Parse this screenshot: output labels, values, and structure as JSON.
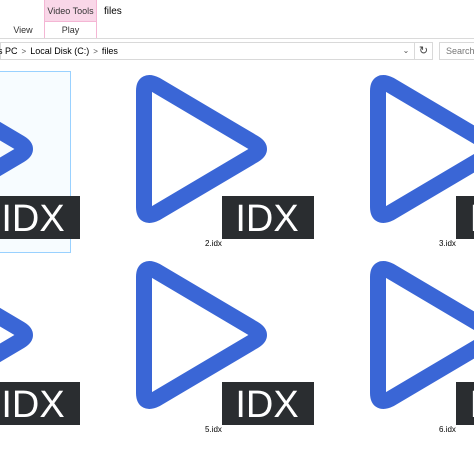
{
  "ribbon": {
    "contextual_group": "Video Tools",
    "contextual_tab": "Play",
    "title": "files",
    "tabs": [
      {
        "label": "View"
      }
    ]
  },
  "address": {
    "crumbs": [
      "s PC",
      "Local Disk (C:)",
      "files"
    ],
    "separator_icon": "chevron-right-icon",
    "dropdown_icon": "chevron-down-icon",
    "refresh_icon": "refresh-icon"
  },
  "search": {
    "placeholder": "Search"
  },
  "files": [
    {
      "name": "",
      "badge": "IDX",
      "selected": true
    },
    {
      "name": "2.idx",
      "badge": "IDX",
      "selected": false
    },
    {
      "name": "3.idx",
      "badge": "IDX",
      "selected": false
    },
    {
      "name": "",
      "badge": "IDX",
      "selected": false
    },
    {
      "name": "5.idx",
      "badge": "IDX",
      "selected": false
    },
    {
      "name": "6.idx",
      "badge": "IDX",
      "selected": false
    }
  ],
  "colors": {
    "play_icon": "#3a66d6",
    "badge_bg": "#2a2d30",
    "badge_text": "#ffffff",
    "contextual_tab_bg": "#f9d7e8",
    "selection_border": "#99d1ff"
  }
}
